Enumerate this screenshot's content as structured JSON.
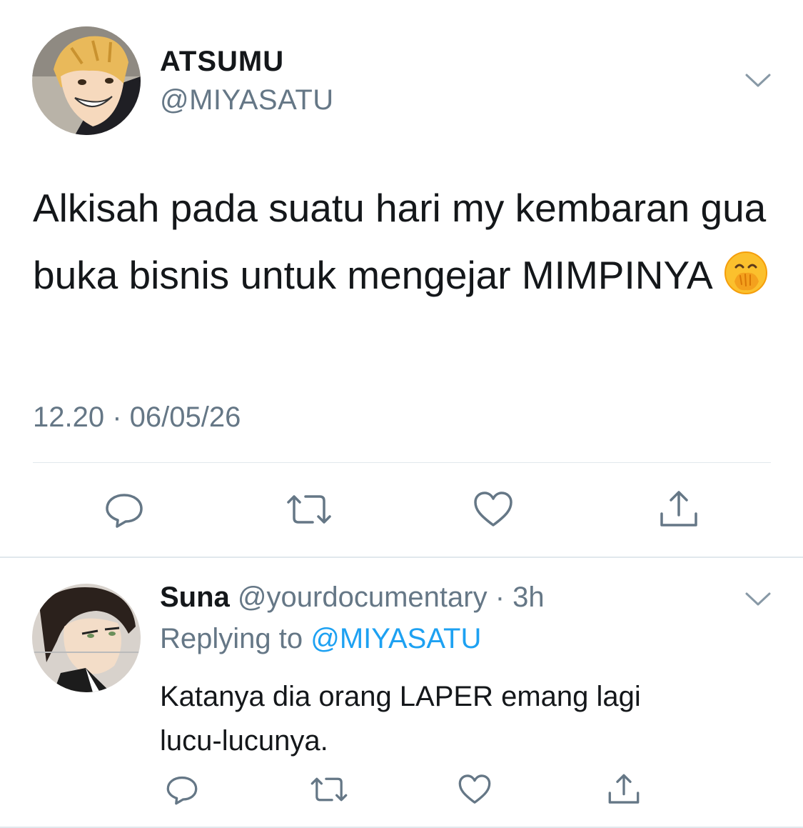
{
  "tweet": {
    "display_name": "ATSUMU",
    "handle": "@MIYASATU",
    "text": "Alkisah pada suatu hari my kembaran gua buka bisnis untuk mengejar MIMPINYA",
    "emoji": "hand-over-mouth-emoji",
    "timestamp": "12.20 · 06/05/26",
    "actions": [
      "reply-icon",
      "retweet-icon",
      "like-icon",
      "share-icon"
    ]
  },
  "reply": {
    "display_name": "Suna",
    "handle": "@yourdocumentary",
    "separator": " · ",
    "time": "3h",
    "replying_prefix": "Replying to ",
    "replying_to": "@MIYASATU",
    "text_line1": "Katanya dia orang LAPER emang lagi",
    "text_line2": "lucu-lucunya.",
    "actions": [
      "reply-icon",
      "retweet-icon",
      "like-icon",
      "share-icon"
    ]
  },
  "colors": {
    "text": "#14171a",
    "secondary": "#657786",
    "link": "#1da1f2",
    "divider": "#e1e8ed",
    "icon": "#657786"
  }
}
